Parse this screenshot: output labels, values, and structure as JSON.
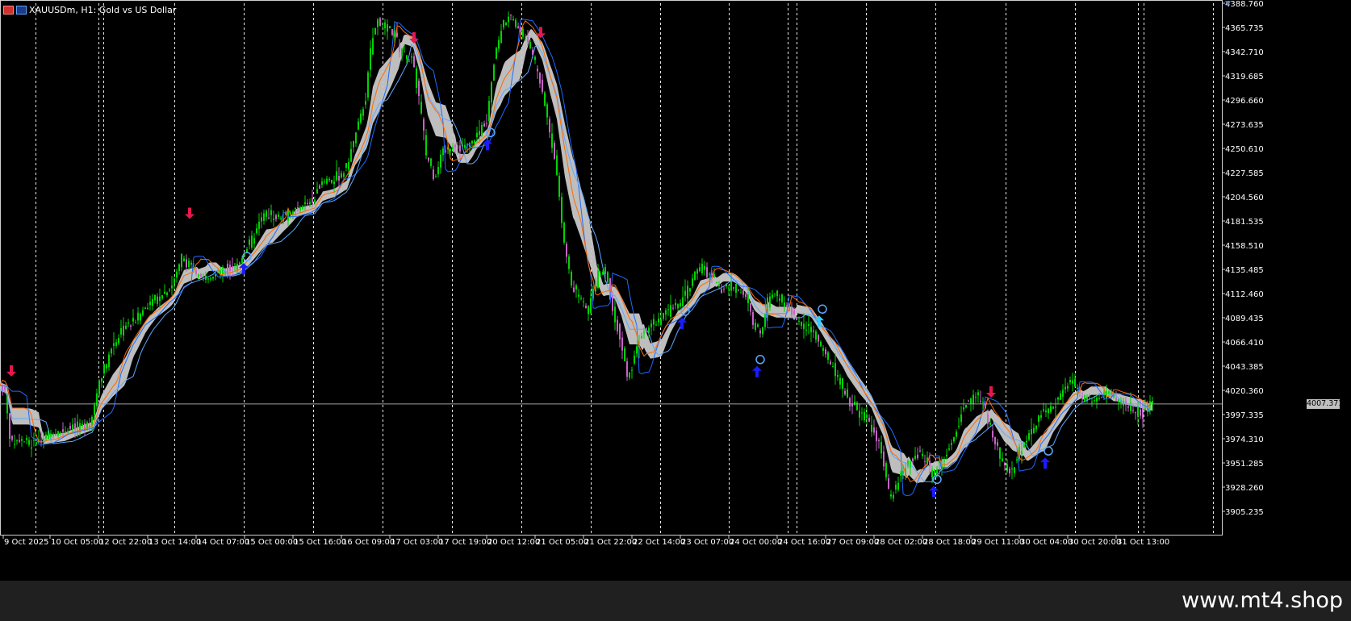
{
  "window": {
    "symbol_title": "XAUUSDm, H1:  Gold vs US Dollar",
    "icons": [
      "chart-window-icon",
      "indicator-icon"
    ]
  },
  "watermark": "www.mt4.shop",
  "current_price": "4007.371",
  "colors": {
    "background": "#000000",
    "grid": "#ffffff",
    "axis_text": "#ffffff",
    "bull_candle": "#00d400",
    "bear_candle": "#c763c7",
    "cloud_band": "#c8c8c8",
    "line_blue": "#1e6bff",
    "line_light_blue": "#5fa8ff",
    "line_orange": "#ff6a00",
    "sell_arrow": "#e8174e",
    "buy_arrow": "#1b1bff",
    "buy_arrow_alt": "#33ccff"
  },
  "chart_data": {
    "type": "candlestick",
    "title": "XAUUSDm, H1:  Gold vs US Dollar",
    "y_ticks": [
      "4388.760",
      "4365.735",
      "4342.710",
      "4319.685",
      "4296.660",
      "4273.635",
      "4250.610",
      "4227.585",
      "4204.560",
      "4181.535",
      "4158.510",
      "4135.485",
      "4112.460",
      "4089.435",
      "4066.410",
      "4043.385",
      "4020.360",
      "3997.335",
      "3974.310",
      "3951.285",
      "3928.260",
      "3905.235"
    ],
    "ylim": [
      3890,
      4392
    ],
    "x_ticks": [
      "9 Oct 2025",
      "10 Oct 05:00",
      "12 Oct 22:00",
      "13 Oct 14:00",
      "14 Oct 07:00",
      "15 Oct 00:00",
      "15 Oct 16:00",
      "16 Oct 09:00",
      "17 Oct 03:00",
      "17 Oct 19:00",
      "20 Oct 12:00",
      "21 Oct 05:00",
      "21 Oct 22:00",
      "22 Oct 14:00",
      "23 Oct 07:00",
      "24 Oct 00:00",
      "24 Oct 16:00",
      "27 Oct 09:00",
      "28 Oct 02:00",
      "28 Oct 18:00",
      "29 Oct 11:00",
      "30 Oct 04:00",
      "30 Oct 20:00",
      "31 Oct 13:00"
    ],
    "price_path": [
      [
        0,
        4025
      ],
      [
        8,
        4020
      ],
      [
        15,
        3970
      ],
      [
        25,
        3975
      ],
      [
        40,
        3968
      ],
      [
        60,
        3978
      ],
      [
        80,
        3982
      ],
      [
        100,
        3985
      ],
      [
        115,
        3990
      ],
      [
        125,
        4030
      ],
      [
        140,
        4060
      ],
      [
        155,
        4080
      ],
      [
        170,
        4088
      ],
      [
        185,
        4102
      ],
      [
        200,
        4110
      ],
      [
        215,
        4120
      ],
      [
        228,
        4150
      ],
      [
        238,
        4135
      ],
      [
        250,
        4128
      ],
      [
        265,
        4128
      ],
      [
        280,
        4135
      ],
      [
        298,
        4142
      ],
      [
        315,
        4165
      ],
      [
        330,
        4190
      ],
      [
        345,
        4185
      ],
      [
        360,
        4188
      ],
      [
        375,
        4195
      ],
      [
        390,
        4200
      ],
      [
        400,
        4220
      ],
      [
        415,
        4220
      ],
      [
        430,
        4230
      ],
      [
        445,
        4270
      ],
      [
        455,
        4300
      ],
      [
        462,
        4350
      ],
      [
        470,
        4372
      ],
      [
        480,
        4365
      ],
      [
        490,
        4360
      ],
      [
        500,
        4340
      ],
      [
        512,
        4335
      ],
      [
        520,
        4305
      ],
      [
        530,
        4245
      ],
      [
        540,
        4225
      ],
      [
        550,
        4245
      ],
      [
        565,
        4255
      ],
      [
        580,
        4250
      ],
      [
        595,
        4265
      ],
      [
        605,
        4280
      ],
      [
        615,
        4340
      ],
      [
        625,
        4370
      ],
      [
        635,
        4375
      ],
      [
        645,
        4365
      ],
      [
        660,
        4345
      ],
      [
        672,
        4315
      ],
      [
        682,
        4270
      ],
      [
        690,
        4240
      ],
      [
        700,
        4165
      ],
      [
        710,
        4120
      ],
      [
        720,
        4110
      ],
      [
        730,
        4095
      ],
      [
        742,
        4130
      ],
      [
        752,
        4135
      ],
      [
        760,
        4100
      ],
      [
        770,
        4070
      ],
      [
        780,
        4030
      ],
      [
        790,
        4060
      ],
      [
        800,
        4080
      ],
      [
        815,
        4085
      ],
      [
        830,
        4095
      ],
      [
        845,
        4105
      ],
      [
        858,
        4120
      ],
      [
        868,
        4140
      ],
      [
        880,
        4130
      ],
      [
        895,
        4118
      ],
      [
        910,
        4120
      ],
      [
        925,
        4110
      ],
      [
        935,
        4085
      ],
      [
        945,
        4075
      ],
      [
        955,
        4110
      ],
      [
        965,
        4112
      ],
      [
        978,
        4100
      ],
      [
        990,
        4085
      ],
      [
        1005,
        4080
      ],
      [
        1020,
        4060
      ],
      [
        1035,
        4040
      ],
      [
        1050,
        4015
      ],
      [
        1065,
        4000
      ],
      [
        1080,
        3990
      ],
      [
        1095,
        3960
      ],
      [
        1105,
        3915
      ],
      [
        1115,
        3935
      ],
      [
        1125,
        3950
      ],
      [
        1140,
        3960
      ],
      [
        1150,
        3955
      ],
      [
        1158,
        3940
      ],
      [
        1170,
        3955
      ],
      [
        1185,
        3975
      ],
      [
        1195,
        4005
      ],
      [
        1210,
        4015
      ],
      [
        1222,
        4005
      ],
      [
        1232,
        3975
      ],
      [
        1245,
        3950
      ],
      [
        1255,
        3940
      ],
      [
        1265,
        3965
      ],
      [
        1275,
        3975
      ],
      [
        1290,
        3995
      ],
      [
        1305,
        4005
      ],
      [
        1320,
        4020
      ],
      [
        1330,
        4030
      ],
      [
        1345,
        4012
      ],
      [
        1360,
        4012
      ],
      [
        1375,
        4018
      ],
      [
        1390,
        4008
      ],
      [
        1405,
        4002
      ],
      [
        1418,
        3998
      ],
      [
        1428,
        4007
      ]
    ],
    "signals": [
      {
        "type": "sell",
        "x_ticks_between": "9 Oct 2025",
        "price": 4035
      },
      {
        "type": "sell",
        "x_ticks_between": "13 Oct 14:00",
        "price": 4185
      },
      {
        "type": "buy",
        "x_ticks_between": "14 Oct 07:00",
        "price": 4140
      },
      {
        "type": "sell",
        "x_ticks_between": "17 Oct 03:00",
        "price": 4352
      },
      {
        "type": "buy",
        "x_ticks_between": "20 Oct 12:00",
        "price": 4258
      },
      {
        "type": "sell",
        "x_ticks_between": "21 Oct 05:00",
        "price": 4357
      },
      {
        "type": "buy",
        "x_ticks_between": "23 Oct 07:00",
        "price": 4088
      },
      {
        "type": "buy",
        "x_ticks_between": "24 Oct 00:00",
        "price": 4042
      },
      {
        "type": "buy",
        "x_ticks_between": "24 Oct 16:00",
        "price": 4090
      },
      {
        "type": "buy",
        "x_ticks_between": "28 Oct 18:00",
        "price": 3928
      },
      {
        "type": "sell",
        "x_ticks_between": "29 Oct 11:00",
        "price": 4015
      },
      {
        "type": "buy",
        "x_ticks_between": "30 Oct 04:00",
        "price": 3955
      }
    ]
  }
}
